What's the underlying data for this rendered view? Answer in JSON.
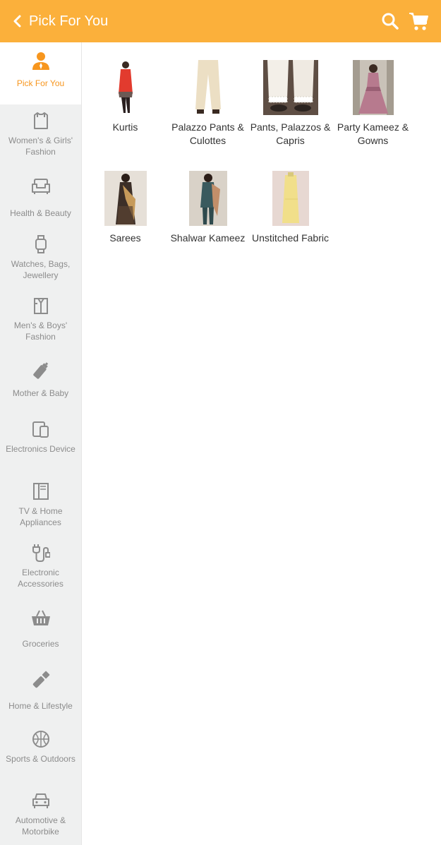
{
  "header": {
    "title": "Pick For You",
    "back_icon": "chevron-left-icon",
    "search_icon": "search-icon",
    "cart_icon": "cart-icon",
    "bg_color": "#FBB03B"
  },
  "sidebar": {
    "items": [
      {
        "label": "Pick For You",
        "icon": "person-icon",
        "active": true
      },
      {
        "label": "Women's & Girls' Fashion",
        "icon": "shirt-icon",
        "active": false
      },
      {
        "label": "Health & Beauty",
        "icon": "sofa-icon",
        "active": false
      },
      {
        "label": "Watches, Bags, Jewellery",
        "icon": "watch-icon",
        "active": false
      },
      {
        "label": "Men's & Boys' Fashion",
        "icon": "mens-shirt-icon",
        "active": false
      },
      {
        "label": "Mother & Baby",
        "icon": "baby-bottle-icon",
        "active": false
      },
      {
        "label": "Electronics Device",
        "icon": "device-icon",
        "active": false
      },
      {
        "label": "TV & Home Appliances",
        "icon": "appliance-icon",
        "active": false
      },
      {
        "label": "Electronic Accessories",
        "icon": "plug-icon",
        "active": false
      },
      {
        "label": "Groceries",
        "icon": "basket-icon",
        "active": false
      },
      {
        "label": "Home & Lifestyle",
        "icon": "brush-icon",
        "active": false
      },
      {
        "label": "Sports & Outdoors",
        "icon": "ball-icon",
        "active": false
      },
      {
        "label": "Automotive & Motorbike",
        "icon": "car-icon",
        "active": false
      }
    ],
    "active_color": "#F7961E"
  },
  "main": {
    "tiles": [
      {
        "label": "Kurtis"
      },
      {
        "label": "Palazzo Pants & Culottes"
      },
      {
        "label": "Pants, Palazzos & Capris"
      },
      {
        "label": "Party Kameez & Gowns"
      },
      {
        "label": "Sarees"
      },
      {
        "label": "Shalwar Kameez"
      },
      {
        "label": "Unstitched Fabric"
      }
    ]
  }
}
